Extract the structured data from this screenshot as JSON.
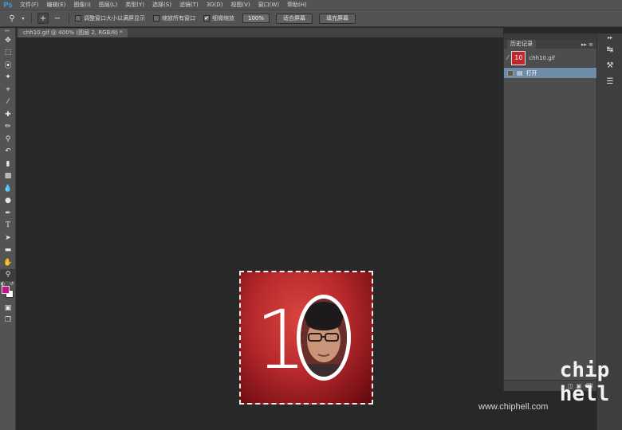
{
  "app": {
    "logo": "Ps"
  },
  "menu": [
    "文件(F)",
    "编辑(E)",
    "图像(I)",
    "图层(L)",
    "类型(Y)",
    "选择(S)",
    "滤镜(T)",
    "3D(D)",
    "视图(V)",
    "窗口(W)",
    "帮助(H)"
  ],
  "options": {
    "resize_windows": "调整窗口大小以满屏显示",
    "zoom_all_windows": "缩放所有窗口",
    "scrubby_zoom": "细微缩放",
    "zoom_value": "100%",
    "fit_screen": "适合屏幕",
    "fill_screen": "填充屏幕",
    "scrubby_checkmark": "✔"
  },
  "document": {
    "tab_title": "chh10.gif @ 400% (图层 2, RGB/8) *",
    "artwork_text": "10"
  },
  "history_panel": {
    "tab_label": "历史记录",
    "snapshot_label": "chh10.gif",
    "snapshot_thumb_text": "10",
    "states": [
      "打开"
    ]
  },
  "watermark": {
    "url": "www.chiphell.com",
    "logo_line1": "chip",
    "logo_line2": "hell"
  },
  "colors": {
    "foreground": "#c0188a",
    "background": "#ffffff",
    "history_selected": "#6e8ba8"
  }
}
